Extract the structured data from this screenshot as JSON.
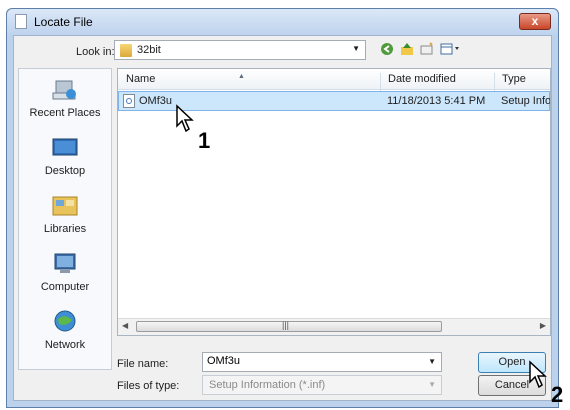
{
  "window": {
    "title": "Locate File",
    "close_label": "x"
  },
  "toolbar": {
    "look_in_label": "Look in:",
    "look_in_value": "32bit"
  },
  "places": [
    {
      "label": "Recent Places",
      "icon": "recent-places-icon"
    },
    {
      "label": "Desktop",
      "icon": "desktop-icon"
    },
    {
      "label": "Libraries",
      "icon": "libraries-icon"
    },
    {
      "label": "Computer",
      "icon": "computer-icon"
    },
    {
      "label": "Network",
      "icon": "network-icon"
    }
  ],
  "columns": {
    "name": "Name",
    "date": "Date modified",
    "type": "Type"
  },
  "files": [
    {
      "name": "OMf3u",
      "date": "11/18/2013 5:41 PM",
      "type": "Setup Info"
    }
  ],
  "scrollbar": {
    "grip": "|||"
  },
  "filename": {
    "label": "File name:",
    "value": "OMf3u"
  },
  "filetype": {
    "label": "Files of type:",
    "value": "Setup Information (*.inf)"
  },
  "buttons": {
    "open": "Open",
    "cancel": "Cancel"
  },
  "callouts": {
    "one": "1",
    "two": "2"
  }
}
